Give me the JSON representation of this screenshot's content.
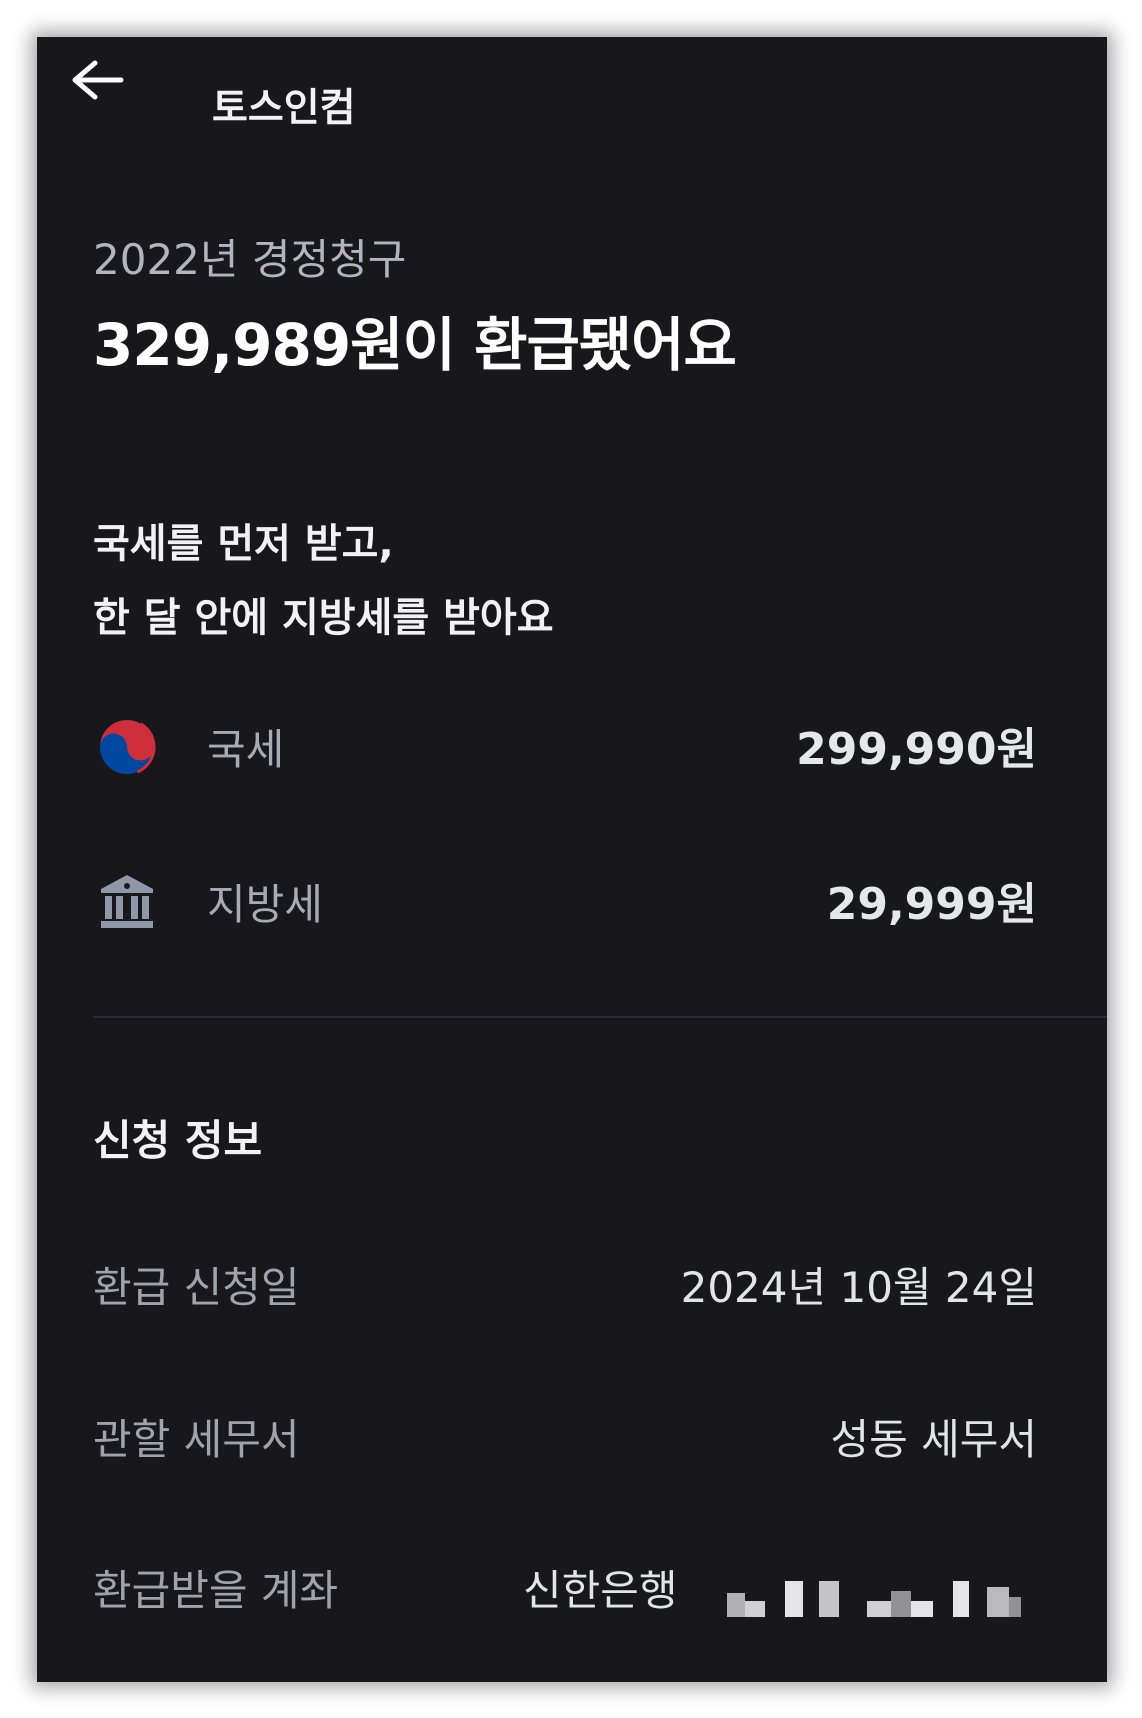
{
  "header": {
    "title": "토스인컴"
  },
  "summary": {
    "year_label": "2022년 경정청구",
    "headline": "329,989원이 환급됐어요"
  },
  "notice": {
    "line1": "국세를 먼저 받고,",
    "line2": "한 달 안에 지방세를 받아요"
  },
  "taxes": [
    {
      "icon": "korea-taeguk-icon",
      "label": "국세",
      "amount": "299,990원"
    },
    {
      "icon": "government-building-icon",
      "label": "지방세",
      "amount": "29,999원"
    }
  ],
  "application_info": {
    "title": "신청 정보",
    "rows": [
      {
        "label": "환급 신청일",
        "value": "2024년 10월 24일"
      },
      {
        "label": "관할 세무서",
        "value": "성동 세무서"
      },
      {
        "label": "환급받을 계좌",
        "value": "신한은행"
      }
    ]
  },
  "colors": {
    "background": "#18181c",
    "primary_text": "#ffffff",
    "secondary_text": "#a7abb4",
    "taeguk_red": "#cd2e3a",
    "taeguk_blue": "#0047a0",
    "building_icon": "#8e98a8"
  }
}
